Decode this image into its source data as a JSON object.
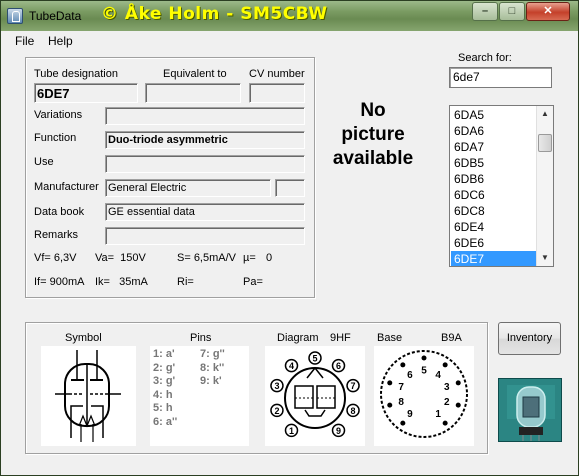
{
  "window": {
    "title": "TubeData",
    "brand": "© Åke Holm - SM5CBW",
    "controls": {
      "minimize": "–",
      "maximize": "□",
      "close": "✕"
    }
  },
  "menu": {
    "file": "File",
    "help": "Help"
  },
  "details": {
    "labels": {
      "designation": "Tube designation",
      "equivalent": "Equivalent to",
      "cv": "CV number",
      "variations": "Variations",
      "function": "Function",
      "use": "Use",
      "manufacturer": "Manufacturer",
      "databook": "Data book",
      "remarks": "Remarks"
    },
    "values": {
      "designation": "6DE7",
      "equivalent": "",
      "cv": "",
      "variations": "",
      "function": "Duo-triode asymmetric",
      "use": "",
      "manufacturer": "General Electric",
      "manufacturer_extra": "",
      "databook": "GE essential data",
      "remarks": ""
    },
    "params": {
      "vf": "Vf= 6,3V",
      "va": "Va=  150V",
      "s": "S= 6,5mA/V",
      "mu": "µ=",
      "mu_value": "0",
      "if": "If= 900mA",
      "ik": "Ik=   35mA",
      "ri": "Ri=",
      "pa": "Pa="
    }
  },
  "picture": {
    "message_line1": "No",
    "message_line2": "picture",
    "message_line3": "available"
  },
  "search": {
    "label": "Search for:",
    "value": "6de7"
  },
  "tube_list": {
    "items": [
      "6DA5",
      "6DA6",
      "6DA7",
      "6DB5",
      "6DB6",
      "6DC6",
      "6DC8",
      "6DE4",
      "6DE6",
      "6DE7"
    ],
    "selected": "6DE7",
    "scroll_up": "▲",
    "scroll_down": "▼"
  },
  "bottom": {
    "symbol_label": "Symbol",
    "pins_label": "Pins",
    "diagram_label": "Diagram",
    "diagram_code": "9HF",
    "base_label": "Base",
    "base_code": "B9A",
    "pins_col1": "1: a'\n2: g'\n3: g'\n4: h\n5: h\n6: a''",
    "pins_col2": "7: g''\n8: k''\n9: k'",
    "diagram_pins": [
      "1",
      "2",
      "3",
      "4",
      "5",
      "6",
      "7",
      "8",
      "9"
    ],
    "base_pins": [
      "1",
      "2",
      "3",
      "4",
      "5",
      "6",
      "7",
      "8",
      "9"
    ]
  },
  "buttons": {
    "inventory": "Inventory"
  }
}
